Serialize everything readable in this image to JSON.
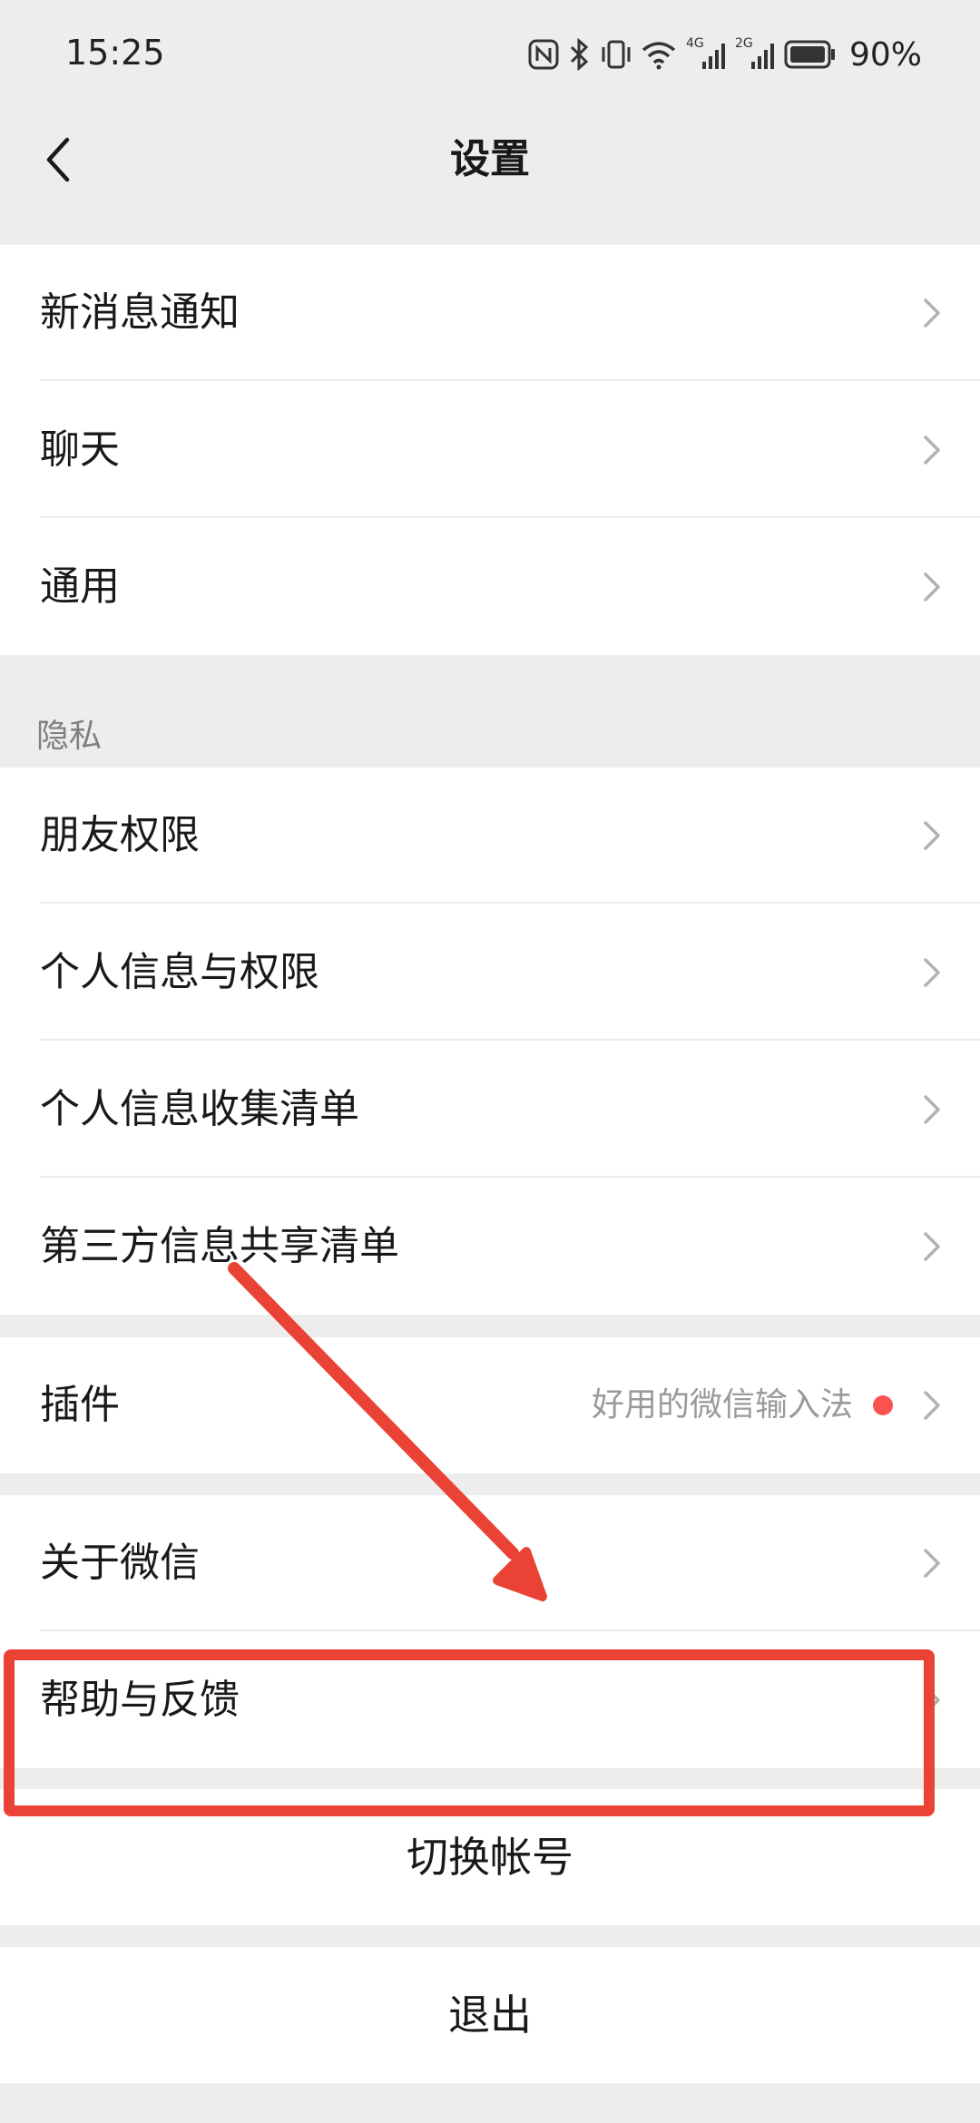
{
  "status_bar": {
    "time": "15:25",
    "battery_percent": "90%",
    "icons": [
      "nfc-icon",
      "bluetooth-icon",
      "vibrate-icon",
      "wifi-icon",
      "signal-4g-icon",
      "signal-2g-icon",
      "battery-icon"
    ],
    "network_labels": [
      "4G",
      "2G"
    ]
  },
  "nav": {
    "title": "设置",
    "back_icon": "chevron-left-icon"
  },
  "groups": {
    "general": [
      "新消息通知",
      "聊天",
      "通用"
    ],
    "privacy_header": "隐私",
    "privacy": [
      "朋友权限",
      "个人信息与权限",
      "个人信息收集清单",
      "第三方信息共享清单"
    ],
    "plugins": {
      "label": "插件",
      "hint": "好用的微信输入法",
      "badge_color": "#fa5151"
    },
    "about": [
      "关于微信",
      "帮助与反馈"
    ]
  },
  "actions": {
    "switch_account": "切换帐号",
    "logout": "退出"
  },
  "annotation": {
    "color": "#ea4335",
    "target": "帮助与反馈"
  }
}
